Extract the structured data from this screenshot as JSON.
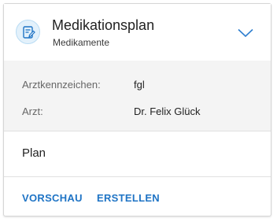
{
  "header": {
    "title": "Medikationsplan",
    "subtitle": "Medikamente",
    "icon": "document-edit-icon",
    "expand_icon": "chevron-down-icon"
  },
  "details": {
    "rows": [
      {
        "label": "Arztkennzeichen:",
        "value": "fgl"
      },
      {
        "label": "Arzt:",
        "value": "Dr. Felix Glück"
      }
    ]
  },
  "plan": {
    "label": "Plan"
  },
  "actions": {
    "preview_label": "VORSCHAU",
    "create_label": "ERSTELLEN"
  },
  "colors": {
    "accent": "#1f74c5",
    "icon_bg": "#e3f1fb",
    "details_bg": "#f4f4f4"
  }
}
